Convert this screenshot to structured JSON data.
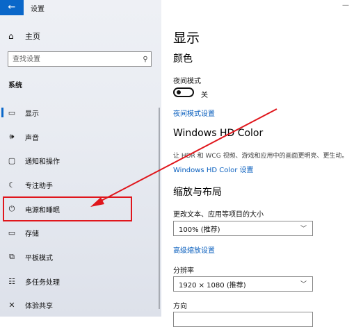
{
  "window": {
    "back_symbol": "←",
    "title": "设置",
    "minimize_symbol": "—"
  },
  "sidebar": {
    "home_label": "主页",
    "search_placeholder": "查找设置",
    "section_label": "系统",
    "items": [
      {
        "label": "显示",
        "icon": "monitor-icon"
      },
      {
        "label": "声音",
        "icon": "speaker-icon"
      },
      {
        "label": "通知和操作",
        "icon": "notification-icon"
      },
      {
        "label": "专注助手",
        "icon": "moon-icon"
      },
      {
        "label": "电源和睡眠",
        "icon": "power-icon"
      },
      {
        "label": "存储",
        "icon": "storage-icon"
      },
      {
        "label": "平板模式",
        "icon": "tablet-icon"
      },
      {
        "label": "多任务处理",
        "icon": "multitask-icon"
      },
      {
        "label": "体验共享",
        "icon": "share-icon"
      }
    ]
  },
  "main": {
    "title": "显示",
    "color_heading": "颜色",
    "night_mode_label": "夜间模式",
    "night_mode_state": "关",
    "night_mode_settings_link": "夜间模式设置",
    "hdr_heading": "Windows HD Color",
    "hdr_desc": "让 HDR 和 WCG 视频、游戏和应用中的画面更明亮、更生动。",
    "hdr_link": "Windows HD Color 设置",
    "scale_heading": "缩放与布局",
    "scale_label": "更改文本、应用等项目的大小",
    "scale_value": "100% (推荐)",
    "advanced_scale_link": "高级缩放设置",
    "resolution_label": "分辨率",
    "resolution_value": "1920 × 1080 (推荐)",
    "orientation_label": "方向"
  },
  "colors": {
    "accent": "#0a67c9",
    "annotation": "#e0161c"
  }
}
